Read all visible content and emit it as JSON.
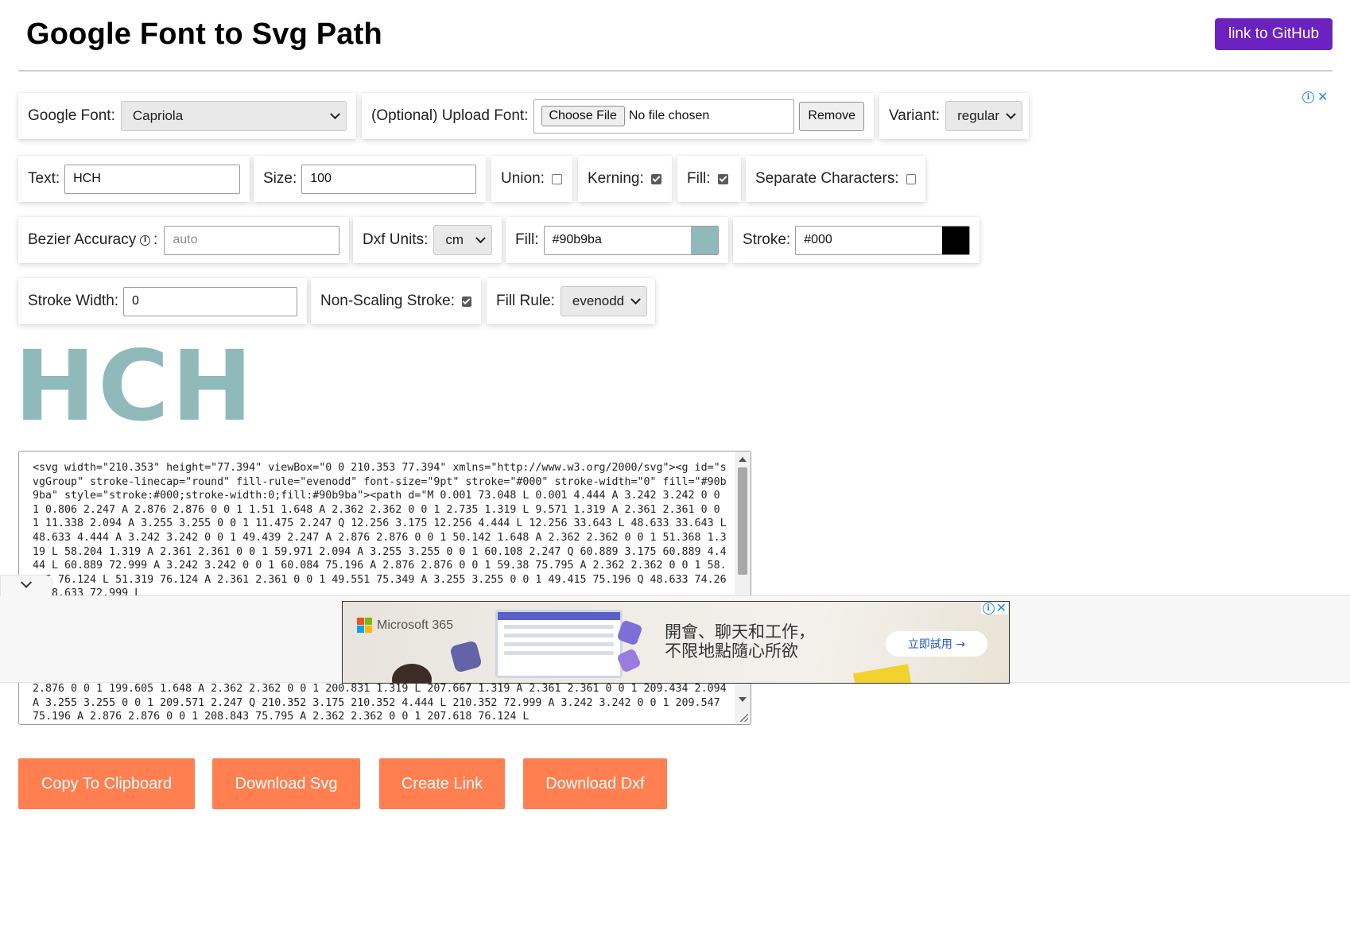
{
  "header": {
    "title": "Google Font to Svg Path",
    "github_label": "link to GitHub"
  },
  "controls": {
    "google_font": {
      "label": "Google Font:",
      "value": "Capriola"
    },
    "upload_font": {
      "label": "(Optional) Upload Font:",
      "choose_label": "Choose File",
      "file_status": "No file chosen",
      "remove_label": "Remove"
    },
    "variant": {
      "label": "Variant:",
      "value": "regular"
    },
    "text": {
      "label": "Text:",
      "value": "HCH"
    },
    "size": {
      "label": "Size:",
      "value": "100"
    },
    "union": {
      "label": "Union:",
      "checked": false
    },
    "kerning": {
      "label": "Kerning:",
      "checked": true
    },
    "fill_toggle": {
      "label": "Fill:",
      "checked": true
    },
    "separate_characters": {
      "label": "Separate Characters:",
      "checked": false
    },
    "bezier_accuracy": {
      "label": "Bezier Accuracy",
      "info_glyph": "i",
      "colon": ":",
      "placeholder": "auto"
    },
    "dxf_units": {
      "label": "Dxf Units:",
      "value": "cm"
    },
    "fill_color": {
      "label": "Fill:",
      "value": "#90b9ba",
      "swatch": "#90b9ba"
    },
    "stroke_color": {
      "label": "Stroke:",
      "value": "#000",
      "swatch": "#000000"
    },
    "stroke_width": {
      "label": "Stroke Width:",
      "value": "0"
    },
    "non_scaling_stroke": {
      "label": "Non-Scaling Stroke:",
      "checked": true
    },
    "fill_rule": {
      "label": "Fill Rule:",
      "value": "evenodd"
    }
  },
  "preview": {
    "text": "HCH",
    "color": "#90b9ba"
  },
  "svg_output": {
    "top_text": "<svg width=\"210.353\" height=\"77.394\" viewBox=\"0 0 210.353 77.394\" xmlns=\"http://www.w3.org/2000/svg\"><g id=\"svgGroup\" stroke-linecap=\"round\" fill-rule=\"evenodd\" font-size=\"9pt\" stroke=\"#000\" stroke-width=\"0\" fill=\"#90b9ba\" style=\"stroke:#000;stroke-width:0;fill:#90b9ba\"><path d=\"M 0.001 73.048 L 0.001 4.444 A 3.242 3.242 0 0 1 0.806 2.247 A 2.876 2.876 0 0 1 1.51 1.648 A 2.362 2.362 0 0 1 2.735 1.319 L 9.571 1.319 A 2.361 2.361 0 0 1 11.338 2.094 A 3.255 3.255 0 0 1 11.475 2.247 Q 12.256 3.175 12.256 4.444 L 12.256 33.643 L 48.633 33.643 L 48.633 4.444 A 3.242 3.242 0 0 1 49.439 2.247 A 2.876 2.876 0 0 1 50.142 1.648 A 2.362 2.362 0 0 1 51.368 1.319 L 58.204 1.319 A 2.361 2.361 0 0 1 59.971 2.094 A 3.255 3.255 0 0 1 60.108 2.247 Q 60.889 3.175 60.889 4.444 L 60.889 72.999 A 3.242 3.242 0 0 1 60.084 75.196 A 2.876 2.876 0 0 1 59.38 75.795 A 2.362 2.362 0 0 1 58.155 76.124 L 51.319 76.124 A 2.361 2.361 0 0 1 49.551 75.349 A 3.255 3.255 0 0 1 49.415 75.196 Q 48.633 74.268 48.633 72.999 L",
    "bottom_text": "2.876 0 0 1 199.605 1.648 A 2.362 2.362 0 0 1 200.831 1.319 L 207.667 1.319 A 2.361 2.361 0 0 1 209.434 2.094 A 3.255 3.255 0 0 1 209.571 2.247 Q 210.352 3.175 210.352 4.444 L 210.352 72.999 A 3.242 3.242 0 0 1 209.547 75.196 A 2.876 2.876 0 0 1 208.843 75.795 A 2.362 2.362 0 0 1 207.618 76.124 L"
  },
  "ad": {
    "brand": "Microsoft 365",
    "headline_1": "開會、聊天和工作，",
    "headline_2": "不限地點隨心所欲",
    "cta": "立即試用 →",
    "info_glyph": "i",
    "close_glyph": "✕"
  },
  "actions": {
    "copy": "Copy To Clipboard",
    "download_svg": "Download Svg",
    "create_link": "Create Link",
    "download_dxf": "Download Dxf",
    "color": "#ff7f50"
  }
}
